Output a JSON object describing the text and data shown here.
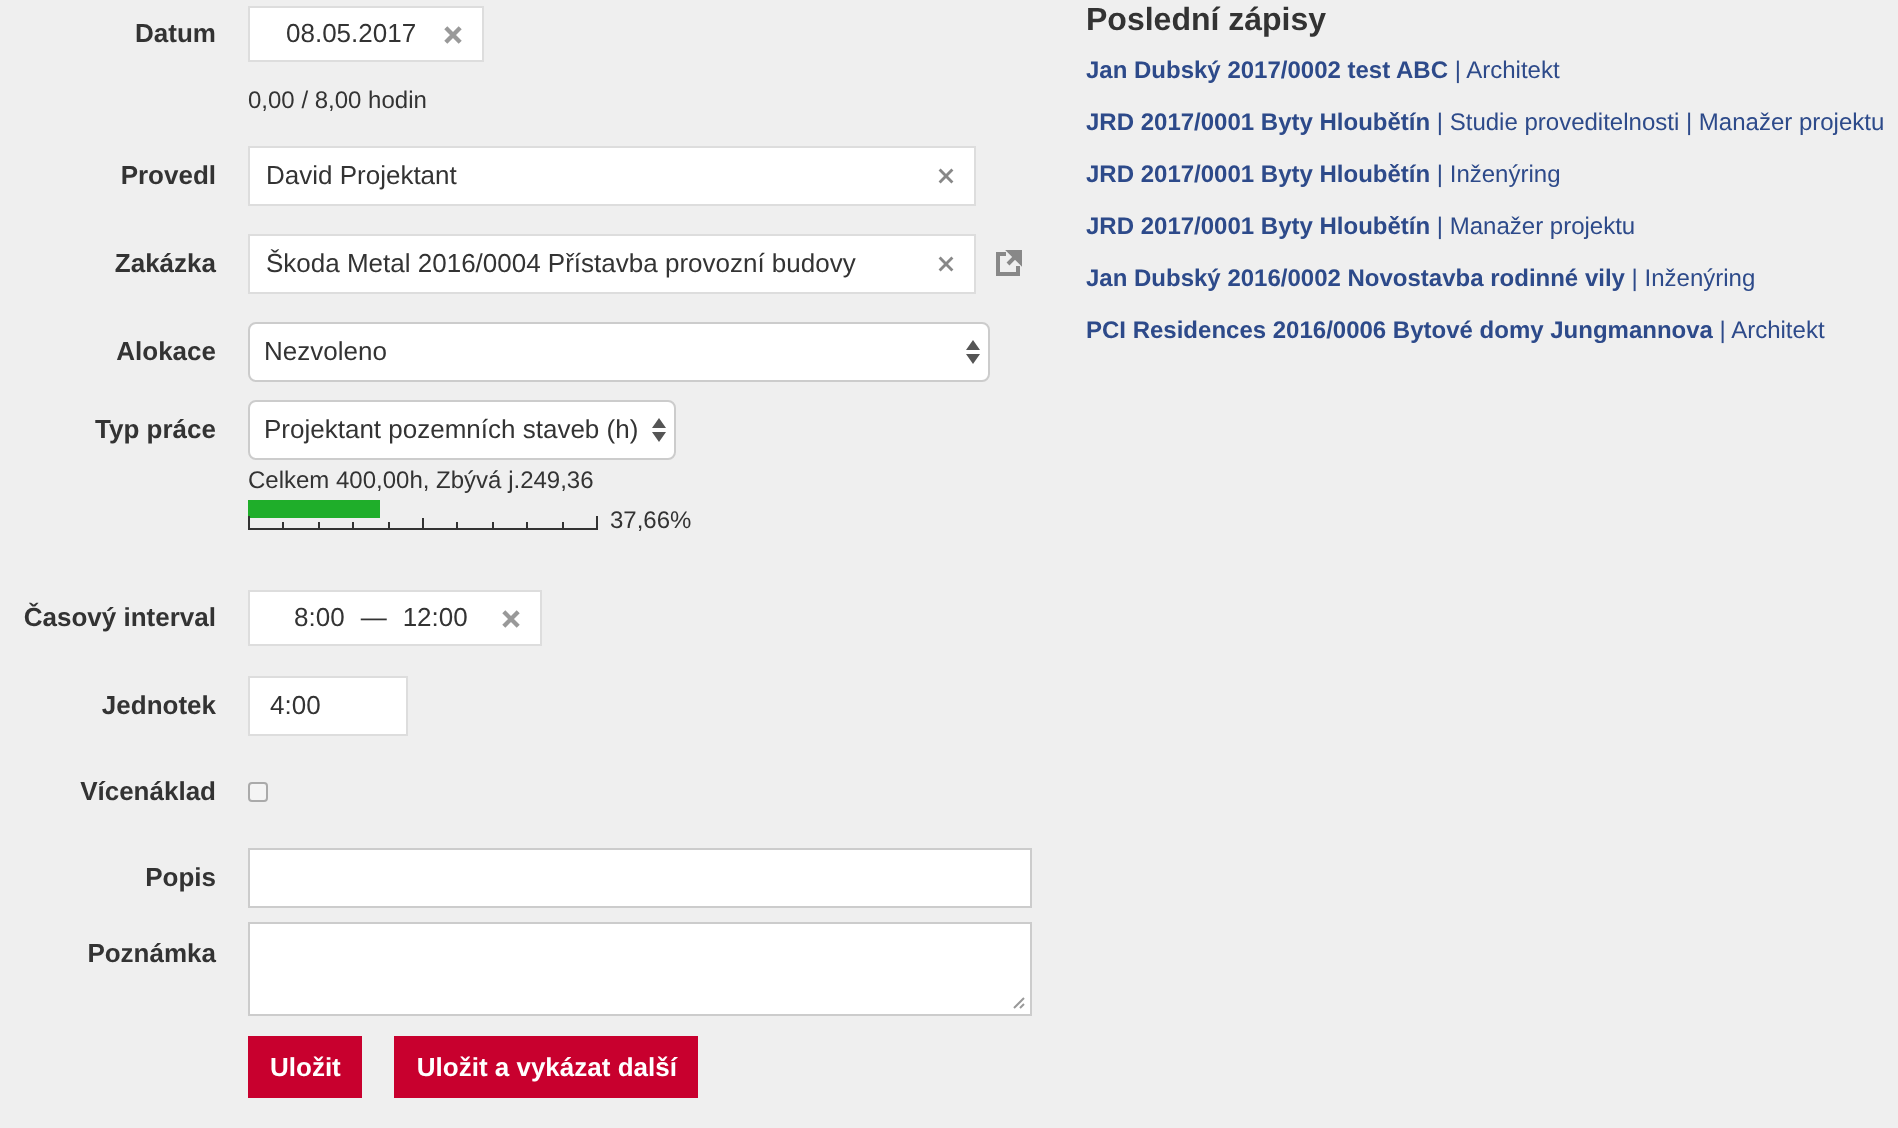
{
  "form": {
    "rows": [
      {
        "kind": "date",
        "label": "Datum",
        "value": "08.05.2017",
        "note": "0,00 / 8,00 hodin"
      },
      {
        "kind": "combo",
        "label": "Provedl",
        "value": "David Projektant"
      },
      {
        "kind": "combo",
        "label": "Zakázka",
        "value": "Škoda Metal 2016/0004 Přístavba provozní budovy",
        "link": true
      },
      {
        "kind": "select",
        "label": "Alokace",
        "value": "Nezvoleno"
      },
      {
        "kind": "select_budget",
        "label": "Typ práce",
        "value": "Projektant pozemních staveb (h)",
        "budget": "Celkem 400,00h, Zbývá j.249,36",
        "level": 0.3766,
        "percent": "37,66%"
      },
      {
        "kind": "interval",
        "label": "Časový interval",
        "from": "8:00",
        "dash": "—",
        "to": "12:00"
      },
      {
        "kind": "text_small",
        "label": "Jednotek",
        "value": "4:00"
      },
      {
        "kind": "checkbox",
        "label": "Vícenáklad",
        "checked": false
      },
      {
        "kind": "text",
        "label": "Popis"
      },
      {
        "kind": "textarea",
        "label": "Poznámka"
      }
    ],
    "buttons": [
      "Uložit",
      "Uložit a vykázat další"
    ]
  },
  "recent": {
    "title": "Poslední zápisy",
    "separator": "|",
    "entries": [
      {
        "project": "Jan Dubský 2017/0002 test ABC",
        "roles": [
          "Architekt"
        ]
      },
      {
        "project": "JRD 2017/0001 Byty Hloubětín",
        "roles": [
          "Studie proveditelnosti",
          "Manažer projektu"
        ]
      },
      {
        "project": "JRD 2017/0001 Byty Hloubětín",
        "roles": [
          "Inženýring"
        ]
      },
      {
        "project": "JRD 2017/0001 Byty Hloubětín",
        "roles": [
          "Manažer projektu"
        ]
      },
      {
        "project": "Jan Dubský 2016/0002 Novostavba rodinné vily",
        "roles": [
          "Inženýring"
        ]
      },
      {
        "project": "PCI Residences 2016/0006 Bytové domy Jungmannova",
        "roles": [
          "Architekt"
        ]
      }
    ]
  }
}
